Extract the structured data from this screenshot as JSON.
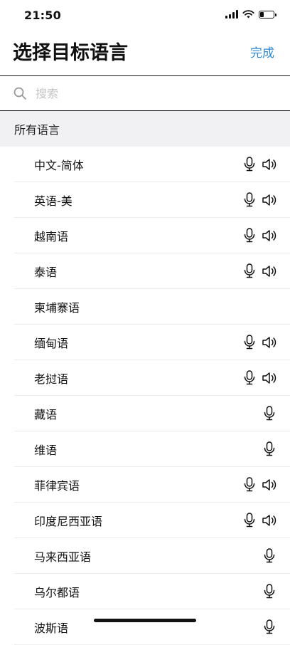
{
  "status_bar": {
    "time": "21:50"
  },
  "header": {
    "title": "选择目标语言",
    "done_label": "完成"
  },
  "search": {
    "placeholder": "搜索"
  },
  "section": {
    "title": "所有语言"
  },
  "colors": {
    "accent": "#2f8ad0",
    "section_bg": "#f1f1f3"
  },
  "languages": [
    {
      "name": "中文-简体",
      "mic": true,
      "speaker": true
    },
    {
      "name": "英语-美",
      "mic": true,
      "speaker": true
    },
    {
      "name": "越南语",
      "mic": true,
      "speaker": true
    },
    {
      "name": "泰语",
      "mic": true,
      "speaker": true
    },
    {
      "name": "柬埔寨语",
      "mic": false,
      "speaker": false
    },
    {
      "name": "缅甸语",
      "mic": true,
      "speaker": true
    },
    {
      "name": "老挝语",
      "mic": true,
      "speaker": true
    },
    {
      "name": "藏语",
      "mic": true,
      "speaker": false
    },
    {
      "name": "维语",
      "mic": true,
      "speaker": false
    },
    {
      "name": "菲律宾语",
      "mic": true,
      "speaker": true
    },
    {
      "name": "印度尼西亚语",
      "mic": true,
      "speaker": true
    },
    {
      "name": "马来西亚语",
      "mic": true,
      "speaker": false
    },
    {
      "name": "乌尔都语",
      "mic": true,
      "speaker": false
    },
    {
      "name": "波斯语",
      "mic": true,
      "speaker": false
    }
  ]
}
